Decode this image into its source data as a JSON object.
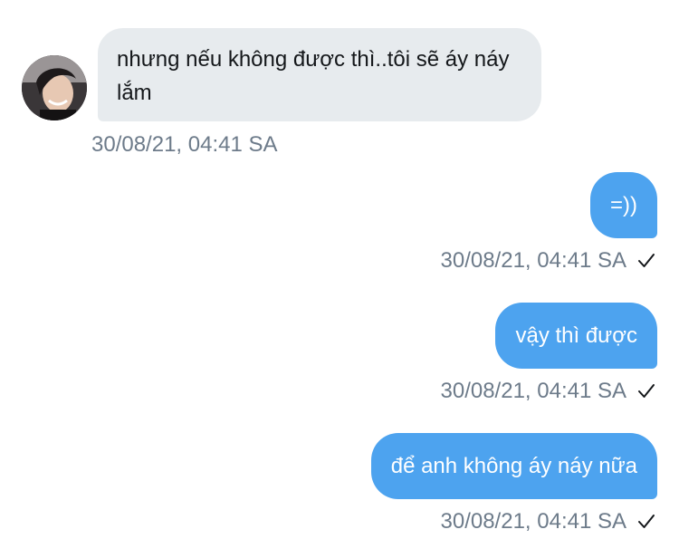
{
  "conversation": {
    "incoming": {
      "text": "nhưng nếu không được thì..tôi sẽ áy náy lắm",
      "timestamp": "30/08/21, 04:41 SA"
    },
    "outgoing": [
      {
        "text": "=))",
        "timestamp": "30/08/21, 04:41 SA",
        "status_icon": "check-icon"
      },
      {
        "text": "vậy thì được",
        "timestamp": "30/08/21, 04:41 SA",
        "status_icon": "check-icon"
      },
      {
        "text": "để anh không áy náy nữa",
        "timestamp": "30/08/21, 04:41 SA",
        "status_icon": "check-icon"
      }
    ]
  },
  "colors": {
    "incoming_bubble": "#e7ebee",
    "outgoing_bubble": "#4da3ef",
    "timestamp": "#6d7b8a"
  }
}
